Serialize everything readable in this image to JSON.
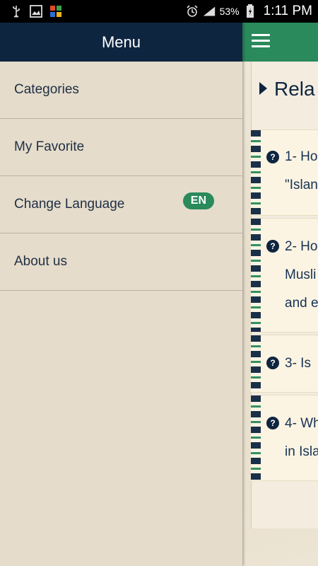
{
  "status_bar": {
    "icons": [
      "usb-icon",
      "image-icon",
      "app-icon"
    ],
    "right_icons": [
      "alarm-icon",
      "signal-icon",
      "battery-icon"
    ],
    "battery": "53%",
    "time": "1:11 PM"
  },
  "drawer": {
    "title": "Menu",
    "items": [
      {
        "label": "Categories"
      },
      {
        "label": "My Favorite"
      },
      {
        "label": "Change Language",
        "badge": "EN"
      },
      {
        "label": "About us"
      }
    ]
  },
  "background_app": {
    "section_title": "Rela",
    "questions": [
      {
        "lines": [
          "1- Ho",
          "\"Islan"
        ]
      },
      {
        "lines": [
          "2- Ho",
          "Musli",
          "and e"
        ]
      },
      {
        "lines": [
          "3- Is"
        ]
      },
      {
        "lines": [
          "4- Wh",
          "in Isla"
        ]
      }
    ]
  },
  "colors": {
    "header": "#0e2540",
    "accent": "#2a8a5c",
    "drawer_bg": "#e5dccb"
  }
}
